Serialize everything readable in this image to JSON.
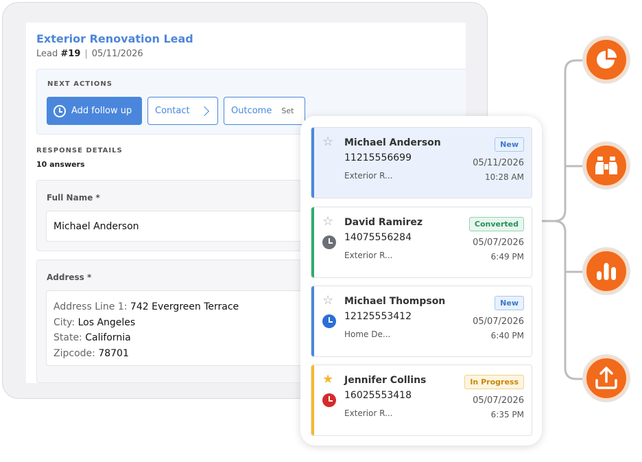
{
  "lead": {
    "title": "Exterior Renovation Lead",
    "meta_prefix": "Lead",
    "number": "#19",
    "separator": "|",
    "date": "05/11/2026"
  },
  "next_actions": {
    "label": "NEXT ACTIONS",
    "follow_up_label": "Add follow up",
    "contact_label": "Contact",
    "outcome_label": "Outcome",
    "outcome_value": "Set"
  },
  "response": {
    "label": "RESPONSE DETAILS",
    "count": "10 answers",
    "full_name_label": "Full Name *",
    "full_name_value": "Michael Anderson",
    "address_label": "Address *",
    "address": {
      "line1_label": "Address Line 1:",
      "line1_value": "742 Evergreen Terrace",
      "city_label": "City:",
      "city_value": "Los Angeles",
      "state_label": "State:",
      "state_value": "California",
      "zip_label": "Zipcode:",
      "zip_value": "78701"
    }
  },
  "leads_list": [
    {
      "name": "Michael Anderson",
      "phone": "11215556699",
      "sub": "Exterior R...",
      "status": "New",
      "date": "05/11/2026",
      "time": "10:28 AM",
      "starred": false,
      "bar_color": "#4a87dc",
      "clock_color": "",
      "selected": true
    },
    {
      "name": "David Ramirez",
      "phone": "14075556284",
      "sub": "Exterior R...",
      "status": "Converted",
      "date": "05/07/2026",
      "time": "6:49 PM",
      "starred": false,
      "bar_color": "#2eae6b",
      "clock_color": "#6b6f76",
      "selected": false
    },
    {
      "name": "Michael Thompson",
      "phone": "12125553412",
      "sub": "Home De...",
      "status": "New",
      "date": "05/07/2026",
      "time": "6:40 PM",
      "starred": false,
      "bar_color": "#4a87dc",
      "clock_color": "#2b6fd6",
      "selected": false
    },
    {
      "name": "Jennifer Collins",
      "phone": "16025553418",
      "sub": "Exterior R...",
      "status": "In Progress",
      "date": "05/07/2026",
      "time": "6:35 PM",
      "starred": true,
      "bar_color": "#f5b82a",
      "clock_color": "#d52b2b",
      "selected": false
    }
  ],
  "features": [
    {
      "icon": "pie-chart-icon"
    },
    {
      "icon": "binoculars-icon"
    },
    {
      "icon": "bar-chart-icon"
    },
    {
      "icon": "upload-icon"
    }
  ],
  "colors": {
    "brand_blue": "#4a87dc",
    "feature_orange": "#f26a1b"
  }
}
